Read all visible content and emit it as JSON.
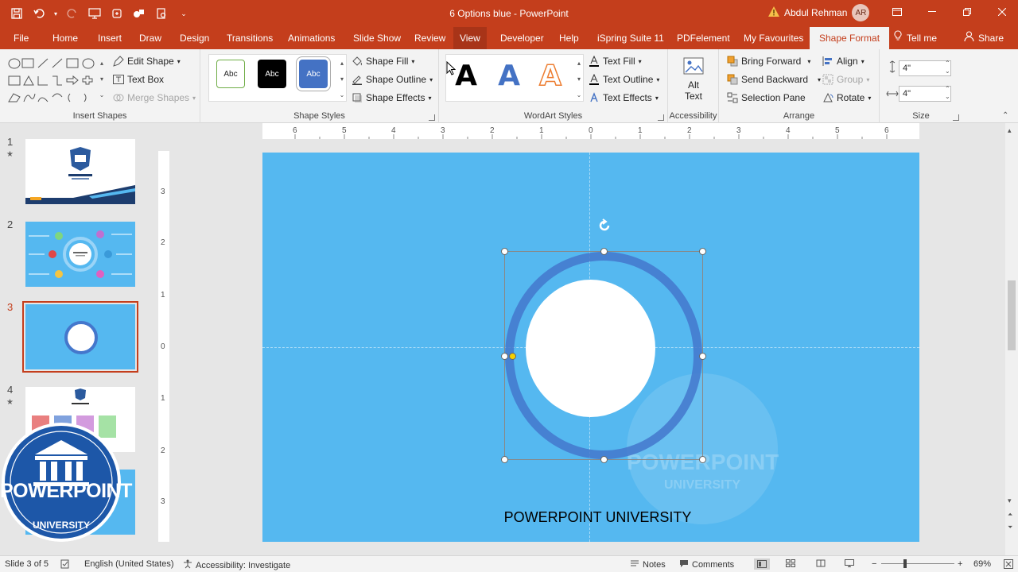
{
  "window": {
    "doc_title": "6 Options blue  -  PowerPoint",
    "user_name": "Abdul Rehman",
    "user_initials": "AR"
  },
  "tabs": [
    "File",
    "Home",
    "Insert",
    "Draw",
    "Design",
    "Transitions",
    "Animations",
    "Slide Show",
    "Review",
    "View",
    "Developer",
    "Help",
    "iSpring Suite 11",
    "PDFelement",
    "My Favourites",
    "Shape Format"
  ],
  "tell_me": "Tell me",
  "share": "Share",
  "ribbon": {
    "insert_shapes": {
      "label": "Insert Shapes",
      "edit_shape": "Edit Shape",
      "text_box": "Text Box",
      "merge_shapes": "Merge Shapes"
    },
    "shape_styles": {
      "label": "Shape Styles",
      "samples": [
        "Abc",
        "Abc",
        "Abc"
      ],
      "shape_fill": "Shape Fill",
      "shape_outline": "Shape Outline",
      "shape_effects": "Shape Effects"
    },
    "wordart": {
      "label": "WordArt Styles",
      "samples": [
        "A",
        "A",
        "A"
      ],
      "text_fill": "Text Fill",
      "text_outline": "Text Outline",
      "text_effects": "Text Effects"
    },
    "accessibility": {
      "label": "Accessibility",
      "alt_text_1": "Alt",
      "alt_text_2": "Text"
    },
    "arrange": {
      "label": "Arrange",
      "bring_forward": "Bring Forward",
      "send_backward": "Send Backward",
      "selection_pane": "Selection Pane",
      "align": "Align",
      "group": "Group",
      "rotate": "Rotate"
    },
    "size": {
      "label": "Size",
      "height": "4\"",
      "width": "4\""
    }
  },
  "ruler": {
    "h_ticks": [
      "6",
      "5",
      "4",
      "3",
      "2",
      "1",
      "0",
      "1",
      "2",
      "3",
      "4",
      "5",
      "6"
    ],
    "v_ticks": [
      "3",
      "2",
      "1",
      "0",
      "1",
      "2",
      "3"
    ]
  },
  "slides": [
    {
      "number": "1",
      "starred": true
    },
    {
      "number": "2",
      "starred": false
    },
    {
      "number": "3",
      "starred": false,
      "selected": true
    },
    {
      "number": "4",
      "starred": true
    }
  ],
  "slide": {
    "footer_text": "POWERPOINT UNIVERSITY",
    "watermark_line1": "POWERPOINT",
    "watermark_line2": "UNIVERSITY",
    "bg_color": "#55b8f0",
    "ring_color": "#4477cc",
    "inner_color": "#ffffff"
  },
  "logo": {
    "line1": "POWERPOINT",
    "line2": "UNIVERSITY",
    "color": "#1d57a8"
  },
  "status": {
    "slide_info": "Slide 3 of 5",
    "language": "English (United States)",
    "accessibility": "Accessibility: Investigate",
    "notes": "Notes",
    "comments": "Comments",
    "zoom": "69%"
  },
  "colors": {
    "accent": "#c43e1c",
    "ribbon_bg": "#f3f3f3"
  }
}
